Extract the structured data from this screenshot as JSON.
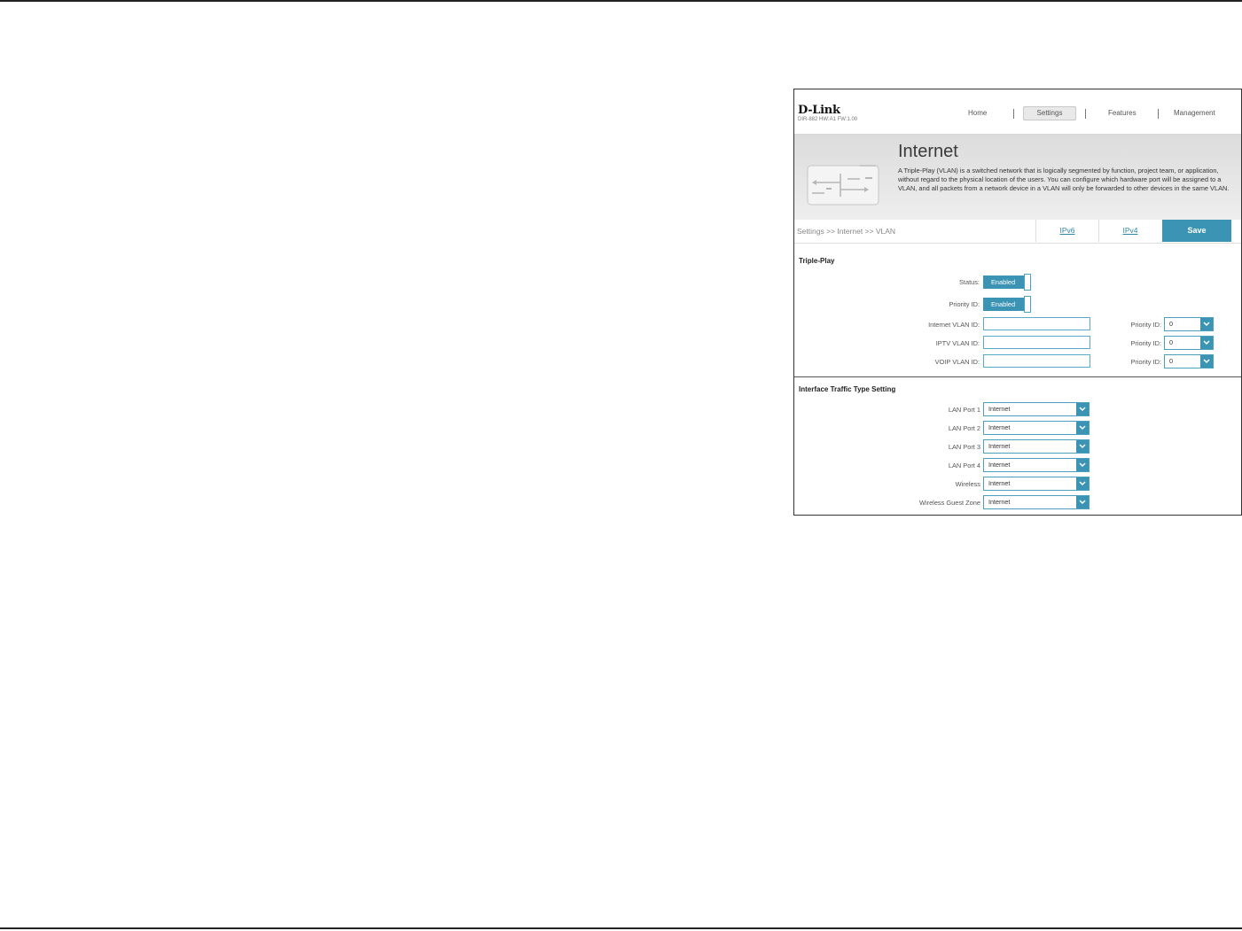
{
  "header": {
    "logo": "D-Link",
    "model": "DIR-882 HW:A1 FW:1.00",
    "nav": {
      "home": "Home",
      "settings": "Settings",
      "features": "Features",
      "management": "Management"
    }
  },
  "banner": {
    "title": "Internet",
    "description": "A Triple-Play (VLAN) is a switched network that is logically segmented by function, project team, or application, without regard to the physical location of the users. You can configure which hardware port will be assigned to a VLAN, and all packets from a network device in a VLAN will only be forwarded to other devices in the same VLAN."
  },
  "breadcrumb": "Settings >> Internet >> VLAN",
  "tabs": {
    "ipv6": "IPv6",
    "ipv4": "IPv4",
    "save": "Save"
  },
  "triple_play": {
    "title": "Triple-Play",
    "status_label": "Status:",
    "status_value": "Enabled",
    "priority_label": "Priority ID:",
    "priority_value": "Enabled",
    "internet_vlan_label": "Internet VLAN ID:",
    "iptv_vlan_label": "IPTV VLAN ID:",
    "voip_vlan_label": "VOIP VLAN ID:",
    "internet_vlan_value": "",
    "iptv_vlan_value": "",
    "voip_vlan_value": "",
    "priority_id_label": "Priority ID:",
    "internet_priority": "0",
    "iptv_priority": "0",
    "voip_priority": "0"
  },
  "traffic": {
    "title": "Interface Traffic Type Setting",
    "rows": [
      {
        "label": "LAN Port 1",
        "value": "Internet"
      },
      {
        "label": "LAN Port 2",
        "value": "Internet"
      },
      {
        "label": "LAN Port 3",
        "value": "Internet"
      },
      {
        "label": "LAN Port 4",
        "value": "Internet"
      },
      {
        "label": "Wireless",
        "value": "Internet"
      },
      {
        "label": "Wireless Guest Zone",
        "value": "Internet"
      }
    ]
  },
  "colors": {
    "accent": "#3c94b4",
    "link": "#2e87a6"
  },
  "icons": {
    "dropdown": "chevron-down-icon",
    "illustration": "vlan-diagram-icon"
  }
}
